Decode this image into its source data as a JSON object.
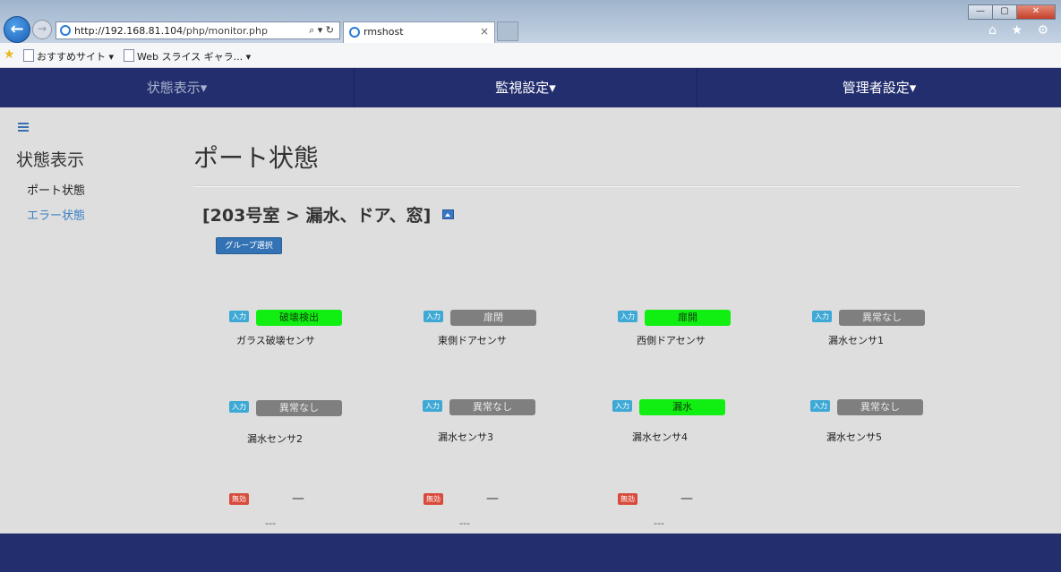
{
  "browser": {
    "address_host": "http://192.168.81.104",
    "address_path": "/php/monitor.php",
    "address_controls": "⌕ ▾ ↻",
    "tab_title": "rmshost",
    "tab_close": "×",
    "window_controls": [
      "—",
      "▢",
      "✕"
    ],
    "toolbar_icons": "⌂ ★ ⚙",
    "favorites": [
      "おすすめサイト ▾",
      "Web スライス ギャラ... ▾"
    ]
  },
  "nav": {
    "items": [
      "状態表示▾",
      "監視設定▾",
      "管理者設定▾"
    ]
  },
  "sidebar": {
    "title": "状態表示",
    "items": [
      "ポート状態",
      "エラー状態"
    ]
  },
  "main": {
    "page_title": "ポート状態",
    "group_title": "[203号室 > 漏水、ドア、窓]",
    "group_button": "グループ選択",
    "ports": [
      {
        "badge": "入力",
        "status": "破壊検出",
        "status_color": "green",
        "name": "ガラス破壊センサ"
      },
      {
        "badge": "入力",
        "status": "扉閉",
        "status_color": "gray",
        "name": "東側ドアセンサ"
      },
      {
        "badge": "入力",
        "status": "扉開",
        "status_color": "green",
        "name": "西側ドアセンサ"
      },
      {
        "badge": "入力",
        "status": "異常なし",
        "status_color": "gray",
        "name": "漏水センサ1"
      },
      {
        "badge": "入力",
        "status": "異常なし",
        "status_color": "gray",
        "name": "漏水センサ2"
      },
      {
        "badge": "入力",
        "status": "異常なし",
        "status_color": "gray",
        "name": "漏水センサ3"
      },
      {
        "badge": "入力",
        "status": "漏水",
        "status_color": "green",
        "name": "漏水センサ4"
      },
      {
        "badge": "入力",
        "status": "異常なし",
        "status_color": "gray",
        "name": "漏水センサ5"
      },
      {
        "badge": "無効",
        "status": "—",
        "name": "---"
      },
      {
        "badge": "無効",
        "status": "—",
        "name": "---"
      },
      {
        "badge": "無効",
        "status": "—",
        "name": "---"
      }
    ]
  },
  "colors": {
    "nav_bg": "#222e6e",
    "status_green": "#11ee11",
    "status_gray": "#7f7f7f",
    "badge_input": "#3fa9d6",
    "badge_disabled": "#d84b3c",
    "button_blue": "#3373b5",
    "link_blue": "#3a7fc4"
  }
}
